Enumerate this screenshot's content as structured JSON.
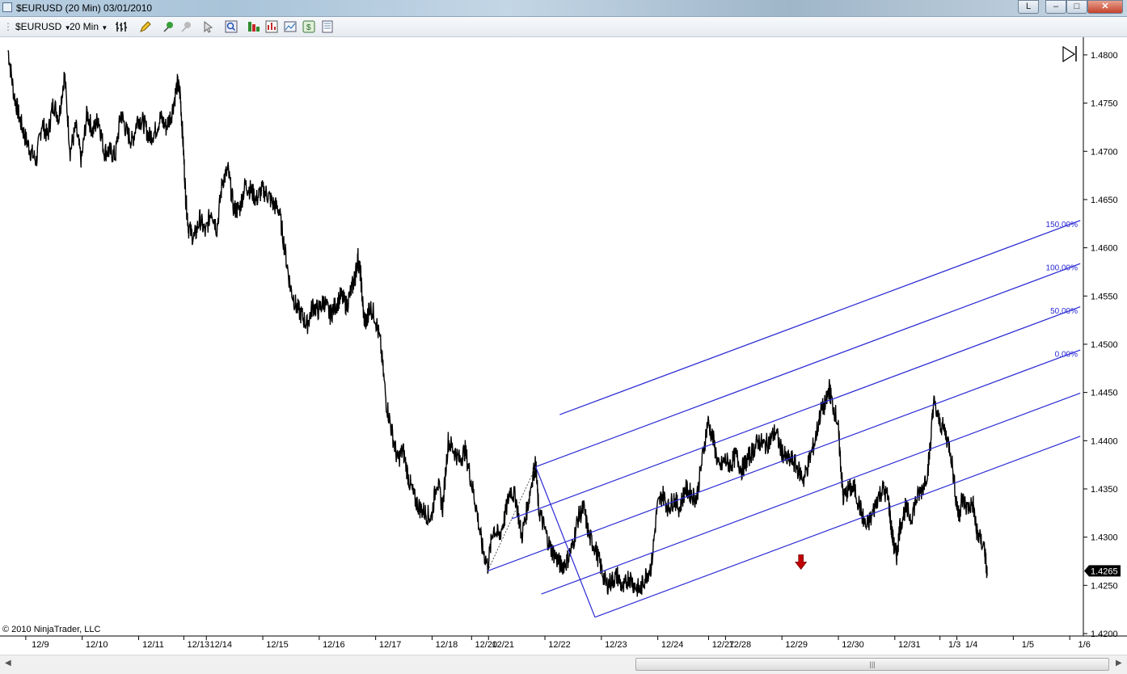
{
  "window": {
    "title": "$EURUSD (20 Min)  03/01/2010",
    "buttons": {
      "layout": "L",
      "minimize": "–",
      "maximize": "□",
      "close": "✕"
    }
  },
  "toolbar": {
    "instrument": "$EURUSD",
    "interval": "20 Min",
    "icons": [
      "bar-type-icon",
      "pencil-draw-icon",
      "pin-icon",
      "pin-disabled-icon",
      "cursor-icon",
      "zoom-icon",
      "indicators-icon",
      "strategies-icon",
      "chart-properties-icon",
      "dollar-icon",
      "data-box-icon"
    ]
  },
  "chart_data": {
    "type": "line",
    "title": "",
    "xlabel": "",
    "ylabel": "",
    "copyright": "© 2010 NinjaTrader, LLC",
    "current_price": "1.4265",
    "ylim": [
      1.42,
      1.4815
    ],
    "y_ticks": [
      "1.4800",
      "1.4750",
      "1.4700",
      "1.4650",
      "1.4600",
      "1.4550",
      "1.4500",
      "1.4450",
      "1.4400",
      "1.4350",
      "1.4300",
      "1.4250",
      "1.4200"
    ],
    "x_ticks": [
      {
        "label": "12/9",
        "i": 0.6
      },
      {
        "label": "12/10",
        "i": 1.6
      },
      {
        "label": "12/11",
        "i": 2.6
      },
      {
        "label": "12/13",
        "i": 3.4
      },
      {
        "label": "12/14",
        "i": 3.8
      },
      {
        "label": "12/15",
        "i": 4.8
      },
      {
        "label": "12/16",
        "i": 5.8
      },
      {
        "label": "12/17",
        "i": 6.8
      },
      {
        "label": "12/18",
        "i": 7.8
      },
      {
        "label": "12/20",
        "i": 8.5
      },
      {
        "label": "12/21",
        "i": 8.8
      },
      {
        "label": "12/22",
        "i": 9.8
      },
      {
        "label": "12/23",
        "i": 10.8
      },
      {
        "label": "12/24",
        "i": 11.8
      },
      {
        "label": "12/27",
        "i": 12.7
      },
      {
        "label": "12/28",
        "i": 13.0
      },
      {
        "label": "12/29",
        "i": 14.0
      },
      {
        "label": "12/30",
        "i": 15.0
      },
      {
        "label": "12/31",
        "i": 16.0
      },
      {
        "label": "1/3",
        "i": 16.8
      },
      {
        "label": "1/4",
        "i": 17.1
      },
      {
        "label": "1/5",
        "i": 18.1
      },
      {
        "label": "1/6",
        "i": 19.1
      }
    ],
    "series": [
      {
        "values": [
          [
            0.0,
            1.4805
          ],
          [
            0.1,
            1.476
          ],
          [
            0.2,
            1.4735
          ],
          [
            0.3,
            1.4715
          ],
          [
            0.4,
            1.47
          ],
          [
            0.5,
            1.469
          ],
          [
            0.6,
            1.473
          ],
          [
            0.7,
            1.4715
          ],
          [
            0.8,
            1.475
          ],
          [
            0.9,
            1.4735
          ],
          [
            1.0,
            1.478
          ],
          [
            1.1,
            1.47
          ],
          [
            1.2,
            1.4725
          ],
          [
            1.3,
            1.469
          ],
          [
            1.4,
            1.474
          ],
          [
            1.5,
            1.472
          ],
          [
            1.6,
            1.4735
          ],
          [
            1.7,
            1.47
          ],
          [
            1.8,
            1.47
          ],
          [
            1.9,
            1.4695
          ],
          [
            2.0,
            1.474
          ],
          [
            2.1,
            1.472
          ],
          [
            2.2,
            1.471
          ],
          [
            2.3,
            1.4735
          ],
          [
            2.4,
            1.473
          ],
          [
            2.5,
            1.4715
          ],
          [
            2.6,
            1.472
          ],
          [
            2.7,
            1.4735
          ],
          [
            2.8,
            1.4725
          ],
          [
            2.9,
            1.474
          ],
          [
            3.0,
            1.477
          ],
          [
            3.05,
            1.476
          ],
          [
            3.1,
            1.471
          ],
          [
            3.15,
            1.465
          ],
          [
            3.2,
            1.462
          ],
          [
            3.3,
            1.461
          ],
          [
            3.4,
            1.463
          ],
          [
            3.5,
            1.4615
          ],
          [
            3.6,
            1.464
          ],
          [
            3.7,
            1.462
          ],
          [
            3.8,
            1.467
          ],
          [
            3.9,
            1.468
          ],
          [
            4.0,
            1.464
          ],
          [
            4.1,
            1.464
          ],
          [
            4.2,
            1.4665
          ],
          [
            4.3,
            1.466
          ],
          [
            4.4,
            1.465
          ],
          [
            4.5,
            1.466
          ],
          [
            4.6,
            1.4655
          ],
          [
            4.7,
            1.4645
          ],
          [
            4.8,
            1.464
          ],
          [
            4.9,
            1.46
          ],
          [
            5.0,
            1.456
          ],
          [
            5.1,
            1.454
          ],
          [
            5.2,
            1.453
          ],
          [
            5.3,
            1.452
          ],
          [
            5.4,
            1.454
          ],
          [
            5.5,
            1.4535
          ],
          [
            5.6,
            1.4545
          ],
          [
            5.7,
            1.453
          ],
          [
            5.8,
            1.454
          ],
          [
            5.9,
            1.455
          ],
          [
            6.0,
            1.454
          ],
          [
            6.1,
            1.456
          ],
          [
            6.15,
            1.457
          ],
          [
            6.2,
            1.459
          ],
          [
            6.25,
            1.457
          ],
          [
            6.3,
            1.453
          ],
          [
            6.35,
            1.452
          ],
          [
            6.4,
            1.454
          ],
          [
            6.5,
            1.453
          ],
          [
            6.6,
            1.45
          ],
          [
            6.7,
            1.444
          ],
          [
            6.8,
            1.441
          ],
          [
            6.9,
            1.438
          ],
          [
            7.0,
            1.439
          ],
          [
            7.1,
            1.436
          ],
          [
            7.2,
            1.434
          ],
          [
            7.3,
            1.433
          ],
          [
            7.4,
            1.4325
          ],
          [
            7.5,
            1.432
          ],
          [
            7.6,
            1.436
          ],
          [
            7.7,
            1.433
          ],
          [
            7.8,
            1.44
          ],
          [
            7.9,
            1.439
          ],
          [
            8.0,
            1.438
          ],
          [
            8.1,
            1.439
          ],
          [
            8.2,
            1.436
          ],
          [
            8.3,
            1.433
          ],
          [
            8.4,
            1.429
          ],
          [
            8.5,
            1.427
          ],
          [
            8.6,
            1.431
          ],
          [
            8.7,
            1.43
          ],
          [
            8.8,
            1.432
          ],
          [
            8.9,
            1.435
          ],
          [
            9.0,
            1.434
          ],
          [
            9.1,
            1.43
          ],
          [
            9.2,
            1.433
          ],
          [
            9.3,
            1.4365
          ],
          [
            9.35,
            1.4375
          ],
          [
            9.4,
            1.433
          ],
          [
            9.5,
            1.431
          ],
          [
            9.6,
            1.429
          ],
          [
            9.7,
            1.428
          ],
          [
            9.8,
            1.427
          ],
          [
            9.9,
            1.4275
          ],
          [
            10.0,
            1.429
          ],
          [
            10.1,
            1.432
          ],
          [
            10.2,
            1.433
          ],
          [
            10.3,
            1.43
          ],
          [
            10.4,
            1.429
          ],
          [
            10.5,
            1.427
          ],
          [
            10.6,
            1.425
          ],
          [
            10.7,
            1.4255
          ],
          [
            10.8,
            1.426
          ],
          [
            10.9,
            1.4245
          ],
          [
            11.0,
            1.426
          ],
          [
            11.1,
            1.425
          ],
          [
            11.2,
            1.4245
          ],
          [
            11.3,
            1.426
          ],
          [
            11.4,
            1.427
          ],
          [
            11.5,
            1.433
          ],
          [
            11.6,
            1.4345
          ],
          [
            11.7,
            1.433
          ],
          [
            11.8,
            1.434
          ],
          [
            11.9,
            1.433
          ],
          [
            12.0,
            1.435
          ],
          [
            12.1,
            1.4345
          ],
          [
            12.2,
            1.434
          ],
          [
            12.3,
            1.438
          ],
          [
            12.4,
            1.442
          ],
          [
            12.5,
            1.44
          ],
          [
            12.6,
            1.437
          ],
          [
            12.7,
            1.438
          ],
          [
            12.8,
            1.4375
          ],
          [
            12.9,
            1.4385
          ],
          [
            13.0,
            1.437
          ],
          [
            13.1,
            1.438
          ],
          [
            13.2,
            1.439
          ],
          [
            13.3,
            1.44
          ],
          [
            13.4,
            1.4395
          ],
          [
            13.5,
            1.44
          ],
          [
            13.6,
            1.441
          ],
          [
            13.7,
            1.439
          ],
          [
            13.8,
            1.438
          ],
          [
            13.9,
            1.438
          ],
          [
            14.0,
            1.437
          ],
          [
            14.1,
            1.436
          ],
          [
            14.2,
            1.438
          ],
          [
            14.3,
            1.44
          ],
          [
            14.4,
            1.443
          ],
          [
            14.5,
            1.444
          ],
          [
            14.55,
            1.4455
          ],
          [
            14.6,
            1.444
          ],
          [
            14.7,
            1.442
          ],
          [
            14.75,
            1.438
          ],
          [
            14.8,
            1.434
          ],
          [
            14.9,
            1.435
          ],
          [
            15.0,
            1.435
          ],
          [
            15.1,
            1.433
          ],
          [
            15.2,
            1.431
          ],
          [
            15.3,
            1.432
          ],
          [
            15.4,
            1.434
          ],
          [
            15.5,
            1.435
          ],
          [
            15.6,
            1.434
          ],
          [
            15.65,
            1.431
          ],
          [
            15.7,
            1.429
          ],
          [
            15.75,
            1.428
          ],
          [
            15.8,
            1.431
          ],
          [
            15.9,
            1.433
          ],
          [
            16.0,
            1.432
          ],
          [
            16.1,
            1.434
          ],
          [
            16.2,
            1.435
          ],
          [
            16.3,
            1.437
          ],
          [
            16.35,
            1.44
          ],
          [
            16.4,
            1.444
          ],
          [
            16.5,
            1.442
          ],
          [
            16.6,
            1.441
          ],
          [
            16.7,
            1.439
          ],
          [
            16.8,
            1.434
          ],
          [
            16.85,
            1.432
          ],
          [
            16.9,
            1.434
          ],
          [
            17.0,
            1.433
          ],
          [
            17.1,
            1.4335
          ],
          [
            17.15,
            1.431
          ],
          [
            17.2,
            1.43
          ],
          [
            17.3,
            1.429
          ],
          [
            17.35,
            1.426
          ]
        ]
      }
    ],
    "pitchfork": {
      "pivots": [
        [
          8.5,
          1.4265
        ],
        [
          9.35,
          1.4373
        ],
        [
          10.4,
          1.4217
        ]
      ],
      "end_i": 19.0,
      "levels": [
        {
          "label": "150.00%",
          "offset": 1.5
        },
        {
          "label": "100.00%",
          "offset": 1.0
        },
        {
          "label": "50.00%",
          "offset": 0.5
        },
        {
          "label": "0.00%",
          "offset": 0.0
        },
        {
          "label": "",
          "offset": -0.5
        },
        {
          "label": "",
          "offset": -1.0
        }
      ],
      "color": "#2a2ad4"
    },
    "colors": {
      "price": "#000000",
      "pitchfork": "#2a2ad4",
      "marker": "#c00000"
    },
    "marker": {
      "type": "down-arrow",
      "i": 14.05,
      "y": 1.427
    }
  }
}
